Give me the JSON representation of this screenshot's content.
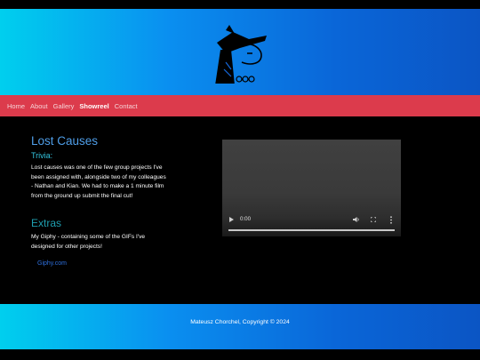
{
  "nav": {
    "items": [
      {
        "label": "Home"
      },
      {
        "label": "About"
      },
      {
        "label": "Gallery"
      },
      {
        "label": "Showreel",
        "active": true
      },
      {
        "label": "Contact"
      }
    ]
  },
  "content": {
    "title": "Lost Causes",
    "trivia_heading": "Trivia:",
    "trivia_text": "Lost causes was one of the few group projects I've been assigned with, alongside two of my colleagues - Nathan and Kian. We had to make a 1 minute film from the ground up submit the final cut!",
    "extras_heading": "Extras",
    "giphy_text": "My Giphy - containing some of the GIFs I've designed for other projects!",
    "giphy_link": "Giphy.com"
  },
  "video": {
    "time": "0:00",
    "progress": 0
  },
  "footer": {
    "text": "Mateusz Chorchel, Copyright © 2024"
  },
  "colors": {
    "nav_bg": "#dc3b4c",
    "title": "#4f9ee8",
    "subhead": "#33c5df",
    "extras": "#1f9fb0",
    "link": "#2e6fdc"
  }
}
